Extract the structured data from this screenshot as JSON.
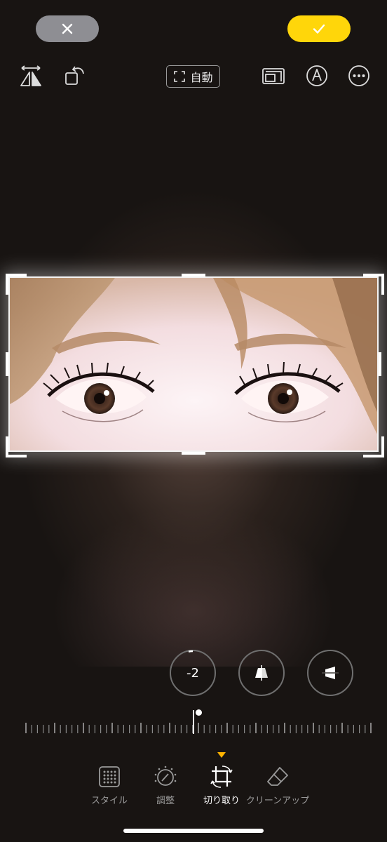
{
  "top_bar": {
    "cancel_icon": "xmark-icon",
    "done_icon": "checkmark-icon",
    "done_color": "#ffd60a"
  },
  "toolbar": {
    "auto_label": "自動",
    "icons": [
      "flip-horizontal-icon",
      "rotate-icon",
      "aspect-ratio-icon",
      "markup-pen-icon",
      "more-icon"
    ]
  },
  "adjust": {
    "straighten_value": "-2",
    "vertical_icon": "vertical-perspective-icon",
    "horizontal_icon": "horizontal-perspective-icon"
  },
  "bottom_tabs": [
    {
      "label": "スタイル",
      "icon": "style-grid-icon"
    },
    {
      "label": "調整",
      "icon": "adjust-dial-icon"
    },
    {
      "label": "切り取り",
      "icon": "crop-rotate-icon",
      "active": true
    },
    {
      "label": "クリーンアップ",
      "icon": "eraser-icon"
    }
  ],
  "accent_color": "#ffb400"
}
